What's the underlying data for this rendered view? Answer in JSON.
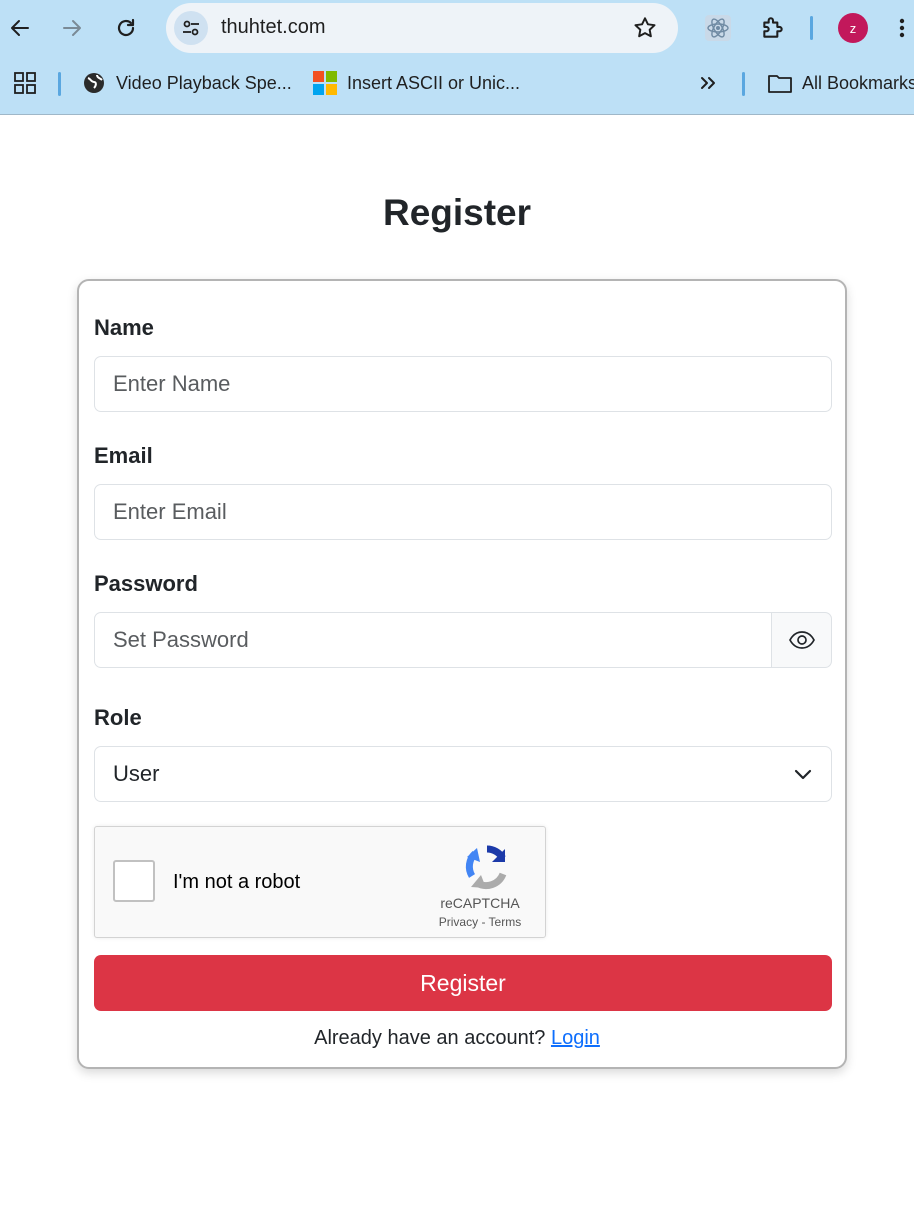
{
  "browser": {
    "url": "thuhtet.com",
    "avatar_letter": "z",
    "bookmarks": [
      {
        "label": "Video Playback Spe...",
        "icon": "globe-icon"
      },
      {
        "label": "Insert ASCII or Unic...",
        "icon": "microsoft-icon"
      }
    ],
    "all_bookmarks_label": "All Bookmarks"
  },
  "page": {
    "title": "Register",
    "name_label": "Name",
    "name_placeholder": "Enter Name",
    "email_label": "Email",
    "email_placeholder": "Enter Email",
    "password_label": "Password",
    "password_placeholder": "Set Password",
    "role_label": "Role",
    "role_value": "User",
    "captcha_text": "I'm not a robot",
    "captcha_brand": "reCAPTCHA",
    "captcha_links": "Privacy - Terms",
    "submit_label": "Register",
    "footer_text": "Already have an account?",
    "login_link": "Login"
  },
  "colors": {
    "accent": "#dc3545",
    "link": "#0d6efd",
    "chrome": "#bde0f6"
  }
}
